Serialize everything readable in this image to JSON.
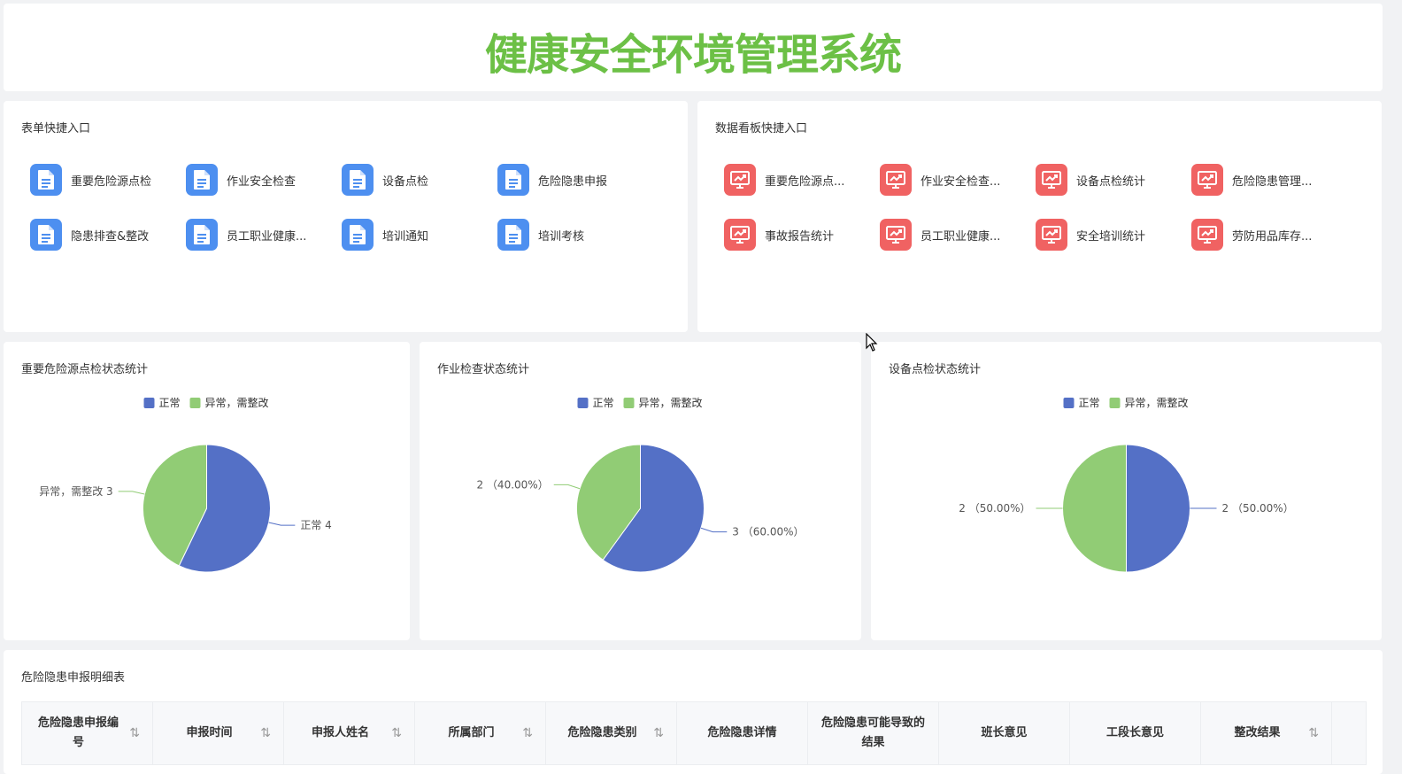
{
  "app": {
    "title": "健康安全环境管理系统"
  },
  "form_shortcuts": {
    "title": "表单快捷入口",
    "items": [
      {
        "label": "重要危险源点检"
      },
      {
        "label": "作业安全检查"
      },
      {
        "label": "设备点检"
      },
      {
        "label": "危险隐患申报"
      },
      {
        "label": "隐患排查&整改"
      },
      {
        "label": "员工职业健康..."
      },
      {
        "label": "培训通知"
      },
      {
        "label": "培训考核"
      }
    ],
    "icon": "document-icon",
    "icon_color": "#4d8ff0"
  },
  "dashboard_shortcuts": {
    "title": "数据看板快捷入口",
    "items": [
      {
        "label": "重要危险源点..."
      },
      {
        "label": "作业安全检查..."
      },
      {
        "label": "设备点检统计"
      },
      {
        "label": "危险隐患管理..."
      },
      {
        "label": "事故报告统计"
      },
      {
        "label": "员工职业健康..."
      },
      {
        "label": "安全培训统计"
      },
      {
        "label": "劳防用品库存..."
      }
    ],
    "icon": "chart-board-icon",
    "icon_color": "#f06262"
  },
  "chart_data": [
    {
      "type": "pie",
      "title": "重要危险源点检状态统计",
      "legend": [
        "正常",
        "异常，需整改"
      ],
      "legend_position": "top-center",
      "slices": [
        {
          "name": "正常",
          "value": 4,
          "color": "#5470c6",
          "label": "正常 4"
        },
        {
          "name": "异常，需整改",
          "value": 3,
          "color": "#91cc75",
          "label": "异常，需整改 3"
        }
      ]
    },
    {
      "type": "pie",
      "title": "作业检查状态统计",
      "legend": [
        "正常",
        "异常，需整改"
      ],
      "legend_position": "top-center",
      "slices": [
        {
          "name": "正常",
          "value": 3,
          "color": "#5470c6",
          "label": "3 （60.00%）"
        },
        {
          "name": "异常，需整改",
          "value": 2,
          "color": "#91cc75",
          "label": "2 （40.00%）"
        }
      ]
    },
    {
      "type": "pie",
      "title": "设备点检状态统计",
      "legend": [
        "正常",
        "异常，需整改"
      ],
      "legend_position": "top-center",
      "slices": [
        {
          "name": "正常",
          "value": 2,
          "color": "#5470c6",
          "label": "2 （50.00%）"
        },
        {
          "name": "异常，需整改",
          "value": 2,
          "color": "#91cc75",
          "label": "2 （50.00%）"
        }
      ]
    }
  ],
  "table": {
    "title": "危险隐患申报明细表",
    "columns": [
      {
        "label": "危险隐患申报编号",
        "sortable": true
      },
      {
        "label": "申报时间",
        "sortable": true
      },
      {
        "label": "申报人姓名",
        "sortable": true
      },
      {
        "label": "所属部门",
        "sortable": true
      },
      {
        "label": "危险隐患类别",
        "sortable": true
      },
      {
        "label": "危险隐患详情",
        "sortable": false
      },
      {
        "label": "危险隐患可能导致的结果",
        "sortable": false
      },
      {
        "label": "班长意见",
        "sortable": false
      },
      {
        "label": "工段长意见",
        "sortable": false
      },
      {
        "label": "整改结果",
        "sortable": true
      }
    ],
    "sort_icon": "sort-arrows-icon"
  }
}
